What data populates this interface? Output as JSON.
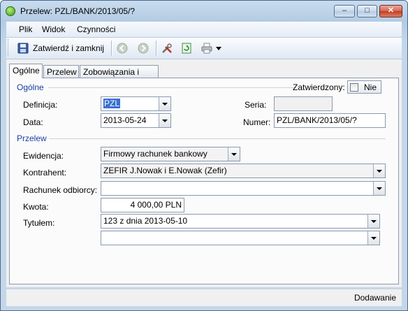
{
  "window": {
    "title": "Przelew: PZL/BANK/2013/05/?",
    "minimize_label": "–",
    "maximize_label": "□",
    "close_label": "✕"
  },
  "menu": {
    "items": [
      "Plik",
      "Widok",
      "Czynności"
    ]
  },
  "toolbar": {
    "confirm_close_label": "Zatwierdź i zamknij",
    "icons": [
      "save-icon",
      "back-icon",
      "forward-icon",
      "tools-icon",
      "refresh-icon",
      "print-icon"
    ]
  },
  "tabs": [
    "Ogólne",
    "Przelew",
    "Zobowiązania i wpłaty"
  ],
  "general": {
    "section_label": "Ogólne",
    "confirmed_label": "Zatwierdzony:",
    "confirmed_value": "Nie",
    "definition_label": "Definicja:",
    "definition_value": "PZL",
    "series_label": "Seria:",
    "series_value": "",
    "date_label": "Data:",
    "date_value": "2013-05-24",
    "number_label": "Numer:",
    "number_value": "PZL/BANK/2013/05/?"
  },
  "transfer": {
    "section_label": "Przelew",
    "register_label": "Ewidencja:",
    "register_value": "Firmowy rachunek bankowy",
    "contractor_label": "Kontrahent:",
    "contractor_value": "ZEFIR J.Nowak i E.Nowak (Zefir)",
    "recipient_account_label": "Rachunek odbiorcy:",
    "recipient_account_value": "",
    "amount_label": "Kwota:",
    "amount_value": "4 000,00 PLN",
    "title_label": "Tytułem:",
    "title_value": "123 z dnia 2013-05-10",
    "title_value_2": ""
  },
  "status": {
    "mode": "Dodawanie"
  },
  "colors": {
    "accent": "#1a3fa0",
    "selection": "#3a6fd0"
  }
}
